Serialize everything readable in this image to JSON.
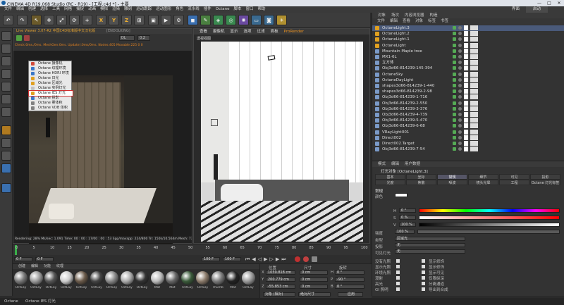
{
  "window": {
    "title": "CINEMA 4D R19.068 Studio (RC - R19) - [工程.c4d *] - 主要",
    "controls": [
      "—",
      "□",
      "✕"
    ]
  },
  "menubar": [
    "文件",
    "编辑",
    "创建",
    "选择",
    "工具",
    "网格",
    "捕捉",
    "动画",
    "模拟",
    "渲染",
    "雕刻",
    "运动跟踪",
    "运动图形",
    "角色",
    "流水线",
    "插件",
    "Octane",
    "脚本",
    "窗口",
    "帮助"
  ],
  "layout_label": "界面",
  "layout_value": "启动",
  "live_viewer": {
    "title": "Live Viewer 3.07-R2 中国C4D标准版中文汉化版",
    "license": "[ENDOLKING]",
    "channel": "DL",
    "value": "0.2",
    "info_text": "Check:0ms./0ms. MeshGen:0ms. Update(:0ms/0ms. Nodes:405 Movable:225  0 0",
    "status": "Rendering: 28%  Ms/sec: 1.091   Time: 00 : 00 : 17/00 : 00 : 53   Spp/maxspp: 224/800   Tri: 150k/10.564m   Mesh: 73   Hair: 0"
  },
  "octane_menu": [
    {
      "label": "Octane 摄像机",
      "icon_color": "#d24a3a"
    },
    {
      "label": "Octane 纹理环境",
      "icon_color": "#3a78c8"
    },
    {
      "label": "Octane HDRI 环境",
      "icon_color": "#3a78c8"
    },
    {
      "label": "Octane 日光",
      "icon_color": "#e0a020"
    },
    {
      "label": "Octane 区域光",
      "icon_color": "#e0a020"
    },
    {
      "label": "Octane 实例灯光",
      "icon_color": "#c0c0c0"
    },
    {
      "label": "Octane IES 灯光",
      "icon_color": "#e0a020"
    },
    {
      "label": "Octane 投影",
      "icon_color": "#3a78c8"
    },
    {
      "label": "Octane 雾体积",
      "icon_color": "#808080"
    },
    {
      "label": "Octane VDB 体积",
      "icon_color": "#808080"
    }
  ],
  "viewport": {
    "menus": [
      "查看",
      "摄像机",
      "显示",
      "选项",
      "过滤",
      "面板",
      "ProRender"
    ],
    "label": "透视视图"
  },
  "object_manager": {
    "tabs": [
      "对象",
      "场次",
      "内容浏览器",
      "构造"
    ],
    "menus": [
      "文件",
      "编辑",
      "查看",
      "对象",
      "标签",
      "书签"
    ],
    "rows": [
      "OctaneLight.3",
      "OctaneLight.2",
      "OctaneLight.1",
      "OctaneLight",
      "Mountain Maple tree",
      "MX1-6L",
      "立方体",
      "Obj3d66-814239-145-394",
      "OctaneSky",
      "OctaneDayLight",
      "shapes3d66-814239-1-440",
      "shapes3d66-814239-2-98",
      "Obj3d66-814239-1-716",
      "Obj3d66-814239-2-550",
      "Obj3d66-814239-3-376",
      "Obj3d66-814239-4-739",
      "Obj3d66-814239-5-470",
      "Obj3d66-814239-6-68",
      "VRayLight001",
      "Direct002",
      "Direct002.Target",
      "Obj3d66-814239-7-54"
    ]
  },
  "attributes": {
    "menus": [
      "模式",
      "编辑",
      "用户数据"
    ],
    "object_title": "灯光对象 [OctaneLight.3]",
    "tabs_row1": [
      "基本",
      "坐标",
      "常规",
      "细节",
      "可见",
      "投影"
    ],
    "tabs_row2": [
      "光度",
      "焦散",
      "噪波",
      "镜头光晕",
      "工程",
      "Octane 灯光标签"
    ],
    "section": "常规",
    "color_label": "颜色",
    "h_label": "H",
    "h_value": "0 °",
    "s_label": "S",
    "s_value": "0 %",
    "v_label": "V",
    "v_value": "100 %",
    "intensity_label": "强度",
    "intensity_value": "100 %",
    "type_label": "类型",
    "type_value": "区域光",
    "shadow_label": "投影",
    "shadow_value": "无",
    "visible_label": "可见灯光",
    "visible_value": "无",
    "checks_col1": [
      "没有光照",
      "显示光照",
      "环境光照",
      "漫射",
      "高光",
      "GI 照明"
    ],
    "checks_col2": [
      "显示修饰",
      "显示修饰",
      "显示可见",
      "仅限纵深",
      "分离通道",
      "导出到合成"
    ]
  },
  "timeline": {
    "ticks": [
      "0",
      "5",
      "10",
      "15",
      "20",
      "25",
      "30",
      "35",
      "40",
      "45",
      "50",
      "55",
      "60",
      "65",
      "70",
      "75",
      "80",
      "85",
      "90",
      "95",
      "100"
    ],
    "current": "0 F",
    "start": "0 F",
    "end": "100 F",
    "end2": "100 F"
  },
  "materials": {
    "menus": [
      "创建",
      "编辑",
      "功能",
      "纹理"
    ],
    "items": [
      "OctLay",
      "OctLay",
      "OctLay",
      "OctLay",
      "OctLay",
      "OctLay",
      "OctLay",
      "OctLay",
      "OctLay",
      "Mat",
      "Mat",
      "OctLay",
      "OctLay",
      "Thumb",
      "Mat",
      "OctLay"
    ]
  },
  "coords": {
    "headers": [
      "位置",
      "尺寸",
      "旋转"
    ],
    "rows": [
      {
        "axis": "X",
        "pos": "1059.818 cm",
        "size": "0 cm",
        "rot_label": "H",
        "rot": "0 °"
      },
      {
        "axis": "Y",
        "pos": "200.779 cm",
        "size": "0 cm",
        "rot_label": "P",
        "rot": "-90 °"
      },
      {
        "axis": "Z",
        "pos": "-55.853 cm",
        "size": "0 cm",
        "rot_label": "B",
        "rot": "0 °"
      }
    ],
    "mode": "对象 (相对)",
    "size_mode": "绝对尺寸",
    "apply": "应用"
  },
  "statusbar": {
    "app": "Octane",
    "selected": "Octane IES 灯光"
  },
  "colors": {
    "accent": "#e89020",
    "selection_outline": "#d03030"
  }
}
